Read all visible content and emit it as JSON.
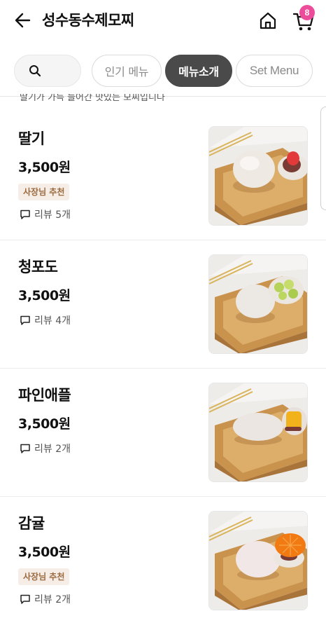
{
  "header": {
    "title": "성수동수제모찌",
    "cart_count": "8",
    "back_icon": "arrow-left-icon",
    "home_icon": "home-icon",
    "cart_icon": "cart-icon"
  },
  "filters": {
    "search_icon": "search-icon",
    "popular_label": "인기 메뉴",
    "active_label": "메뉴소개",
    "setmenu_label": "Set Menu"
  },
  "intro": {
    "cutoff_text": "딸기가 가득 들어간 맛있는 모찌입니다"
  },
  "menu": [
    {
      "name": "딸기",
      "price": "3,500원",
      "badge": "사장님 추천",
      "review": "리뷰 5개",
      "fruit": "strawberry",
      "fruit_color": "#e23a3a"
    },
    {
      "name": "청포도",
      "price": "3,500원",
      "badge": "",
      "review": "리뷰 4개",
      "fruit": "green-grape",
      "fruit_color": "#b5d35a"
    },
    {
      "name": "파인애플",
      "price": "3,500원",
      "badge": "",
      "review": "리뷰 2개",
      "fruit": "pineapple",
      "fruit_color": "#f2b21c"
    },
    {
      "name": "감귤",
      "price": "3,500원",
      "badge": "사장님 추천",
      "review": "리뷰 2개",
      "fruit": "tangerine",
      "fruit_color": "#f27a12"
    }
  ],
  "colors": {
    "accent_badge": "#ec4d9a",
    "active_chip": "#4a4a4a",
    "recommend_bg": "#f6eee6",
    "recommend_text": "#9b6a3f"
  }
}
